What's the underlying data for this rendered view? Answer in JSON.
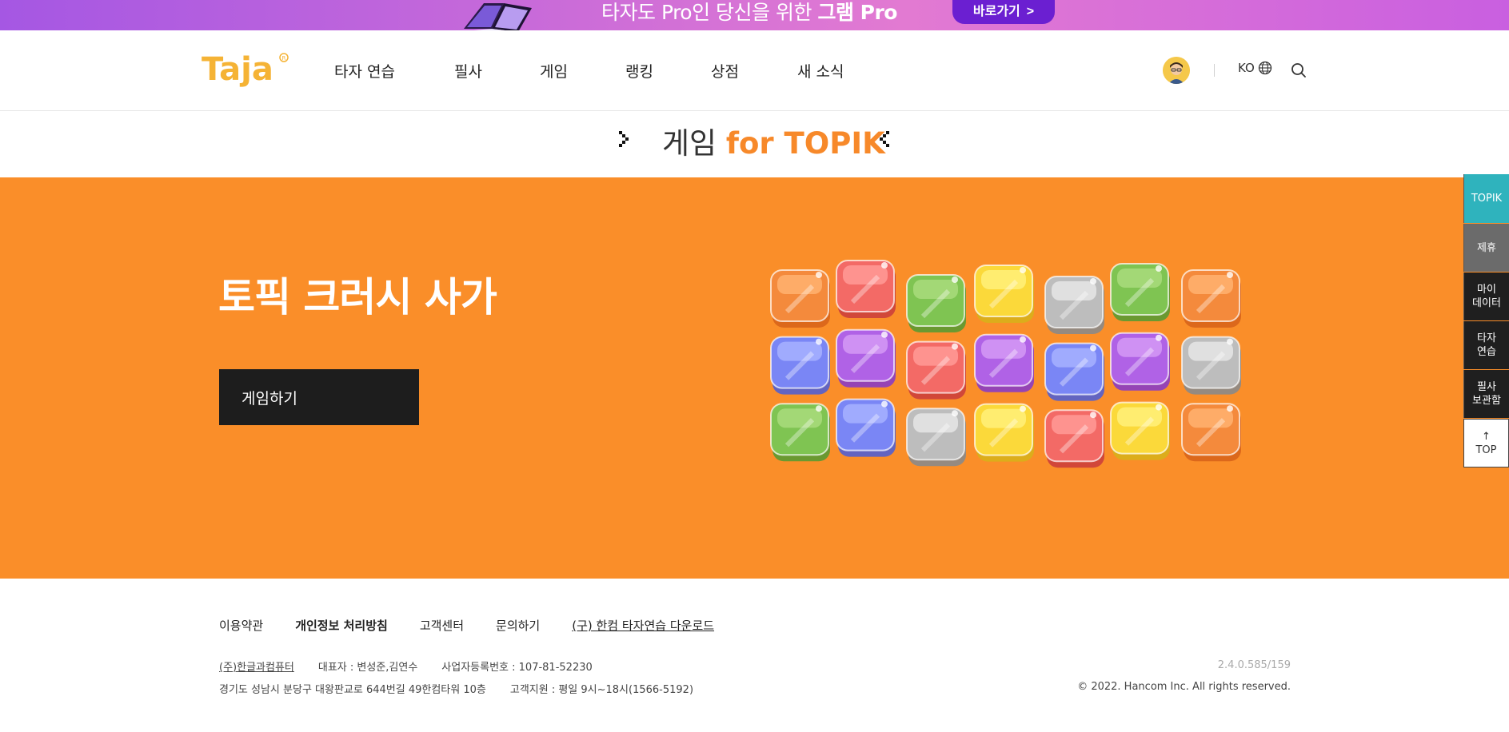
{
  "promo": {
    "text_normal": "타자도 Pro인 당신을 위한 ",
    "text_bold": "그램 Pro",
    "button_label": "바로가기",
    "button_arrow": ">"
  },
  "header": {
    "logo_text": "Taja",
    "nav": [
      "타자 연습",
      "필사",
      "게임",
      "랭킹",
      "상점",
      "새 소식"
    ],
    "lang": "KO"
  },
  "title": {
    "part1": "게임",
    "part2": "for TOPIK"
  },
  "hero": {
    "game_title": "토픽 크러시 사가",
    "play_label": "게임하기"
  },
  "side_menu": {
    "topik": "TOPIK",
    "partner": "제휴",
    "mydata_1": "마이",
    "mydata_2": "데이터",
    "typing_1": "타자",
    "typing_2": "연습",
    "storage_1": "필사",
    "storage_2": "보관함",
    "top_arrow": "↑",
    "top_label": "TOP"
  },
  "footer": {
    "links": [
      "이용약관",
      "개인정보 처리방침",
      "고객센터",
      "문의하기",
      "(구) 한컴 타자연습 다운로드"
    ],
    "company": "(주)한글과컴퓨터",
    "ceo": "대표자 : 변성준,김연수",
    "biz_no": "사업자등록번호 : 107-81-52230",
    "address": "경기도 성남시 분당구 대왕판교로 644번길 49한컴타워 10층",
    "support": "고객지원 : 평일 9시~18시(1566-5192)",
    "version": "2.4.0.585/159",
    "copyright": "© 2022. Hancom Inc. All rights reserved."
  },
  "colors": {
    "accent_orange": "#fa8e29",
    "topik_teal": "#2fb3bd",
    "promo_purple": "#6b1fd1"
  },
  "blocks": {
    "rows": [
      [
        "orange",
        "red",
        "green",
        "yellow",
        "gray",
        "green",
        "orange"
      ],
      [
        "blue",
        "purple",
        "red",
        "purple",
        "blue",
        "purple",
        "gray"
      ],
      [
        "green",
        "blue",
        "gray",
        "yellow",
        "red",
        "yellow",
        "orange"
      ]
    ]
  }
}
